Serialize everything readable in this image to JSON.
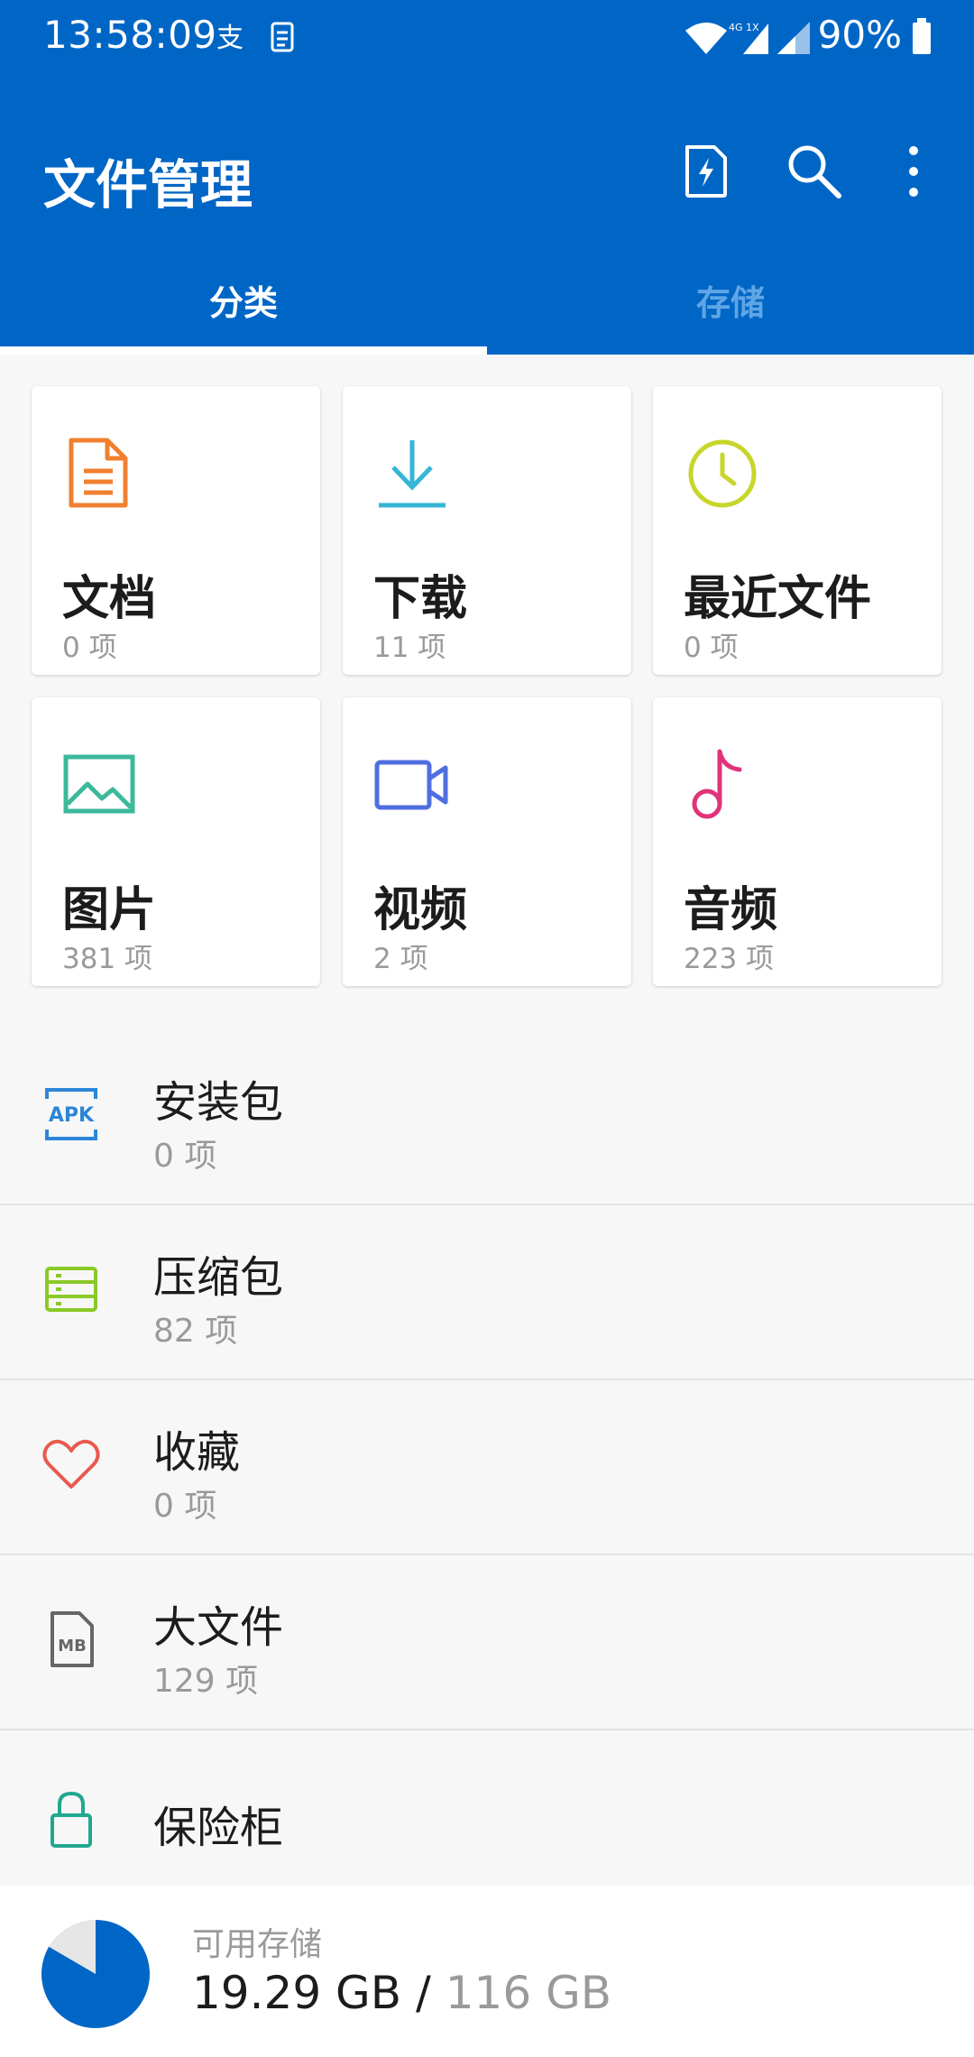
{
  "status_bar": {
    "time": "13:58:09",
    "network": "4G 1X",
    "battery": "90%"
  },
  "app": {
    "title": "文件管理",
    "accent_color": "#0066c6"
  },
  "tabs": [
    {
      "label": "分类",
      "selected": true
    },
    {
      "label": "存储",
      "selected": false
    }
  ],
  "categories": [
    {
      "name": "文档",
      "count": "0 项",
      "icon": "document-icon",
      "color": "#f08030"
    },
    {
      "name": "下载",
      "count": "11 项",
      "icon": "download-icon",
      "color": "#34b6d6"
    },
    {
      "name": "最近文件",
      "count": "0 项",
      "icon": "clock-icon",
      "color": "#c8d62c"
    },
    {
      "name": "图片",
      "count": "381 项",
      "icon": "image-icon",
      "color": "#3cb99b"
    },
    {
      "name": "视频",
      "count": "2 项",
      "icon": "video-icon",
      "color": "#4f6fe0"
    },
    {
      "name": "音频",
      "count": "223 项",
      "icon": "music-icon",
      "color": "#e0337a"
    }
  ],
  "list": [
    {
      "name": "安装包",
      "count": "0 项",
      "icon": "apk-icon",
      "icon_text": "APK",
      "color": "#2c86d8"
    },
    {
      "name": "压缩包",
      "count": "82 项",
      "icon": "archive-icon",
      "color": "#8ac926"
    },
    {
      "name": "收藏",
      "count": "0 项",
      "icon": "heart-icon",
      "color": "#e85a4f"
    },
    {
      "name": "大文件",
      "count": "129 项",
      "icon": "large-file-icon",
      "icon_text": "MB",
      "color": "#666666"
    },
    {
      "name": "保险柜",
      "count": "",
      "icon": "lock-icon",
      "color": "#21a78f"
    }
  ],
  "storage": {
    "label": "可用存储",
    "free": "19.29 GB",
    "separator": " / ",
    "total": "116 GB",
    "used_fraction": 0.834
  }
}
